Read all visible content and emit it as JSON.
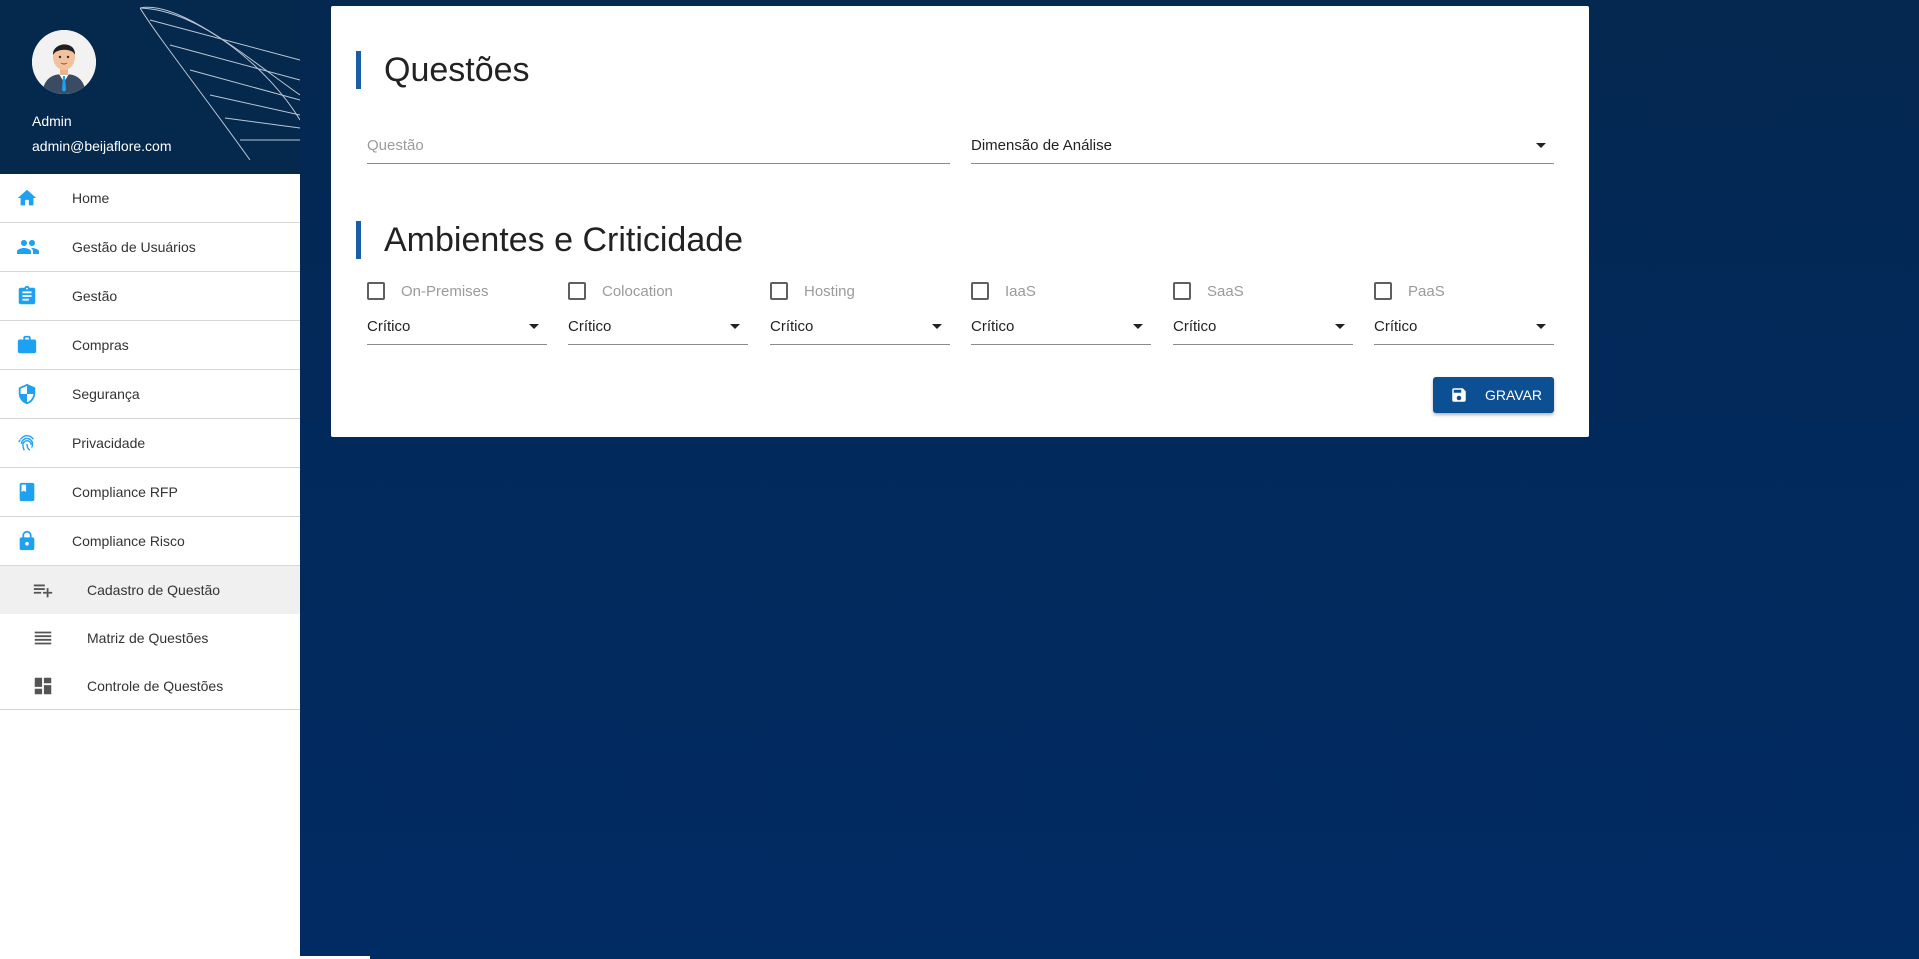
{
  "user": {
    "name": "Admin",
    "email": "admin@beijaflore.com"
  },
  "colors": {
    "sidebar_header": "#05284d",
    "accent": "#1da1f2",
    "primary_button": "#0d4f93",
    "title_bar": "#1b5ea8"
  },
  "nav": [
    {
      "label": "Home",
      "icon": "home-icon"
    },
    {
      "label": "Gestão de Usuários",
      "icon": "users-icon"
    },
    {
      "label": "Gestão",
      "icon": "clipboard-icon"
    },
    {
      "label": "Compras",
      "icon": "briefcase-icon"
    },
    {
      "label": "Segurança",
      "icon": "shield-icon"
    },
    {
      "label": "Privacidade",
      "icon": "fingerprint-icon"
    },
    {
      "label": "Compliance RFP",
      "icon": "book-icon"
    },
    {
      "label": "Compliance Risco",
      "icon": "lock-icon"
    }
  ],
  "subnav": [
    {
      "label": "Cadastro de Questão",
      "icon": "playlist-add-icon",
      "active": true
    },
    {
      "label": "Matriz de Questões",
      "icon": "list-icon",
      "active": false
    },
    {
      "label": "Controle de Questões",
      "icon": "dashboard-icon",
      "active": false
    }
  ],
  "main": {
    "section1_title": "Questões",
    "questao_placeholder": "Questão",
    "dimensao_value": "Dimensão de Análise",
    "section2_title": "Ambientes e Criticidade",
    "environments": [
      {
        "label": "On-Premises",
        "checked": false,
        "criticality": "Crítico"
      },
      {
        "label": "Colocation",
        "checked": false,
        "criticality": "Crítico"
      },
      {
        "label": "Hosting",
        "checked": false,
        "criticality": "Crítico"
      },
      {
        "label": "IaaS",
        "checked": false,
        "criticality": "Crítico"
      },
      {
        "label": "SaaS",
        "checked": false,
        "criticality": "Crítico"
      },
      {
        "label": "PaaS",
        "checked": false,
        "criticality": "Crítico"
      }
    ],
    "save_label": "GRAVAR",
    "save_icon": "floppy-icon"
  }
}
